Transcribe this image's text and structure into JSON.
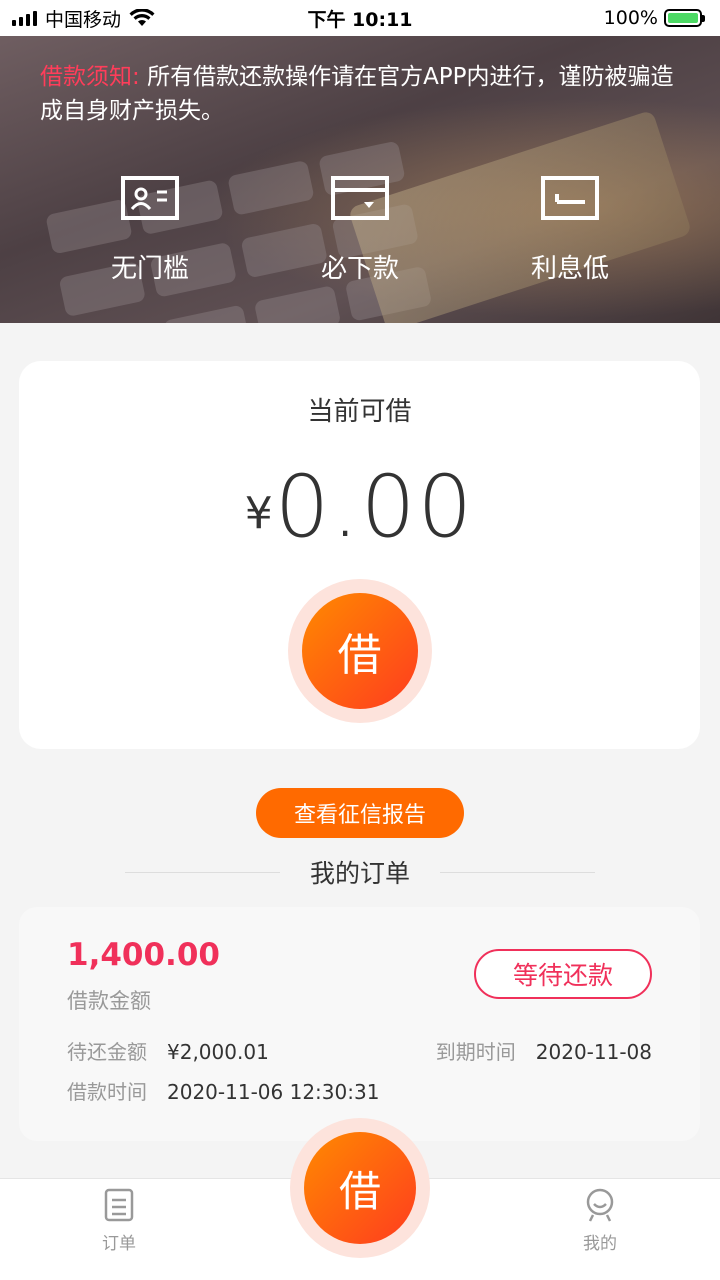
{
  "status_bar": {
    "carrier": "中国移动",
    "time": "下午 10:11",
    "battery": "100%"
  },
  "banner": {
    "notice_label": "借款须知:",
    "notice_text": "所有借款还款操作请在官方APP内进行，谨防被骗造成自身财产损失。",
    "features": [
      {
        "label": "无门槛",
        "icon": "id-card-icon"
      },
      {
        "label": "必下款",
        "icon": "wallet-card-icon"
      },
      {
        "label": "利息低",
        "icon": "bank-card-icon"
      }
    ]
  },
  "loan": {
    "title": "当前可借",
    "currency": "¥",
    "amount": "0.00",
    "borrow_button": "借"
  },
  "credit_report_button": "查看征信报告",
  "orders_title": "我的订单",
  "order": {
    "amount": "1,400.00",
    "amount_label": "借款金额",
    "status": "等待还款",
    "repay_label": "待还金额",
    "repay_value": "¥2,000.01",
    "due_label": "到期时间",
    "due_value": "2020-11-08",
    "borrow_time_label": "借款时间",
    "borrow_time_value": "2020-11-06 12:30:31"
  },
  "tab_bar": {
    "orders": "订单",
    "center": "借",
    "mine": "我的"
  },
  "colors": {
    "accent": "#ff6a00",
    "alert": "#f0305a"
  }
}
